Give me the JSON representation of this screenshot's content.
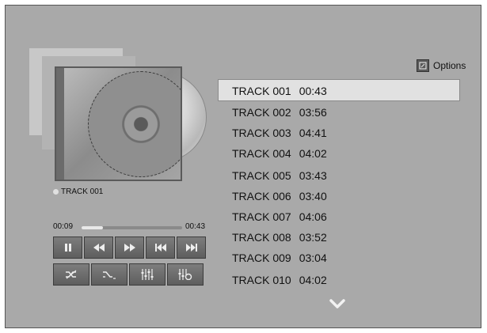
{
  "options": {
    "label": "Options",
    "icon": "options-icon"
  },
  "now_playing": {
    "title": "TRACK 001"
  },
  "player": {
    "elapsed": "00:09",
    "total": "00:43",
    "progress": 0.21,
    "controls": [
      {
        "name": "pause-button",
        "icon": "pause-icon"
      },
      {
        "name": "rewind-button",
        "icon": "rewind-icon"
      },
      {
        "name": "fast-forward-button",
        "icon": "fast-forward-icon"
      },
      {
        "name": "previous-track-button",
        "icon": "previous-icon"
      },
      {
        "name": "next-track-button",
        "icon": "next-icon"
      }
    ],
    "modes": [
      {
        "name": "shuffle-button",
        "icon": "shuffle-icon"
      },
      {
        "name": "repeat-button",
        "icon": "repeat-icon"
      },
      {
        "name": "equalizer-button",
        "icon": "equalizer-icon"
      },
      {
        "name": "sound-settings-button",
        "icon": "sound-settings-icon"
      }
    ]
  },
  "tracks": [
    {
      "title": "TRACK 001",
      "duration": "00:43",
      "selected": true
    },
    {
      "title": "TRACK 002",
      "duration": "03:56"
    },
    {
      "title": "TRACK 003",
      "duration": "04:41"
    },
    {
      "title": "TRACK 004",
      "duration": "04:02"
    },
    {
      "title": "TRACK 005",
      "duration": "03:43"
    },
    {
      "title": "TRACK 006",
      "duration": "03:40"
    },
    {
      "title": "TRACK 007",
      "duration": "04:06"
    },
    {
      "title": "TRACK 008",
      "duration": "03:52"
    },
    {
      "title": "TRACK 009",
      "duration": "03:04"
    },
    {
      "title": "TRACK 010",
      "duration": "04:02"
    }
  ],
  "colors": {
    "background": "#a9a9a9",
    "highlight": "#e1e1e1",
    "button": "#6a6a6a"
  }
}
